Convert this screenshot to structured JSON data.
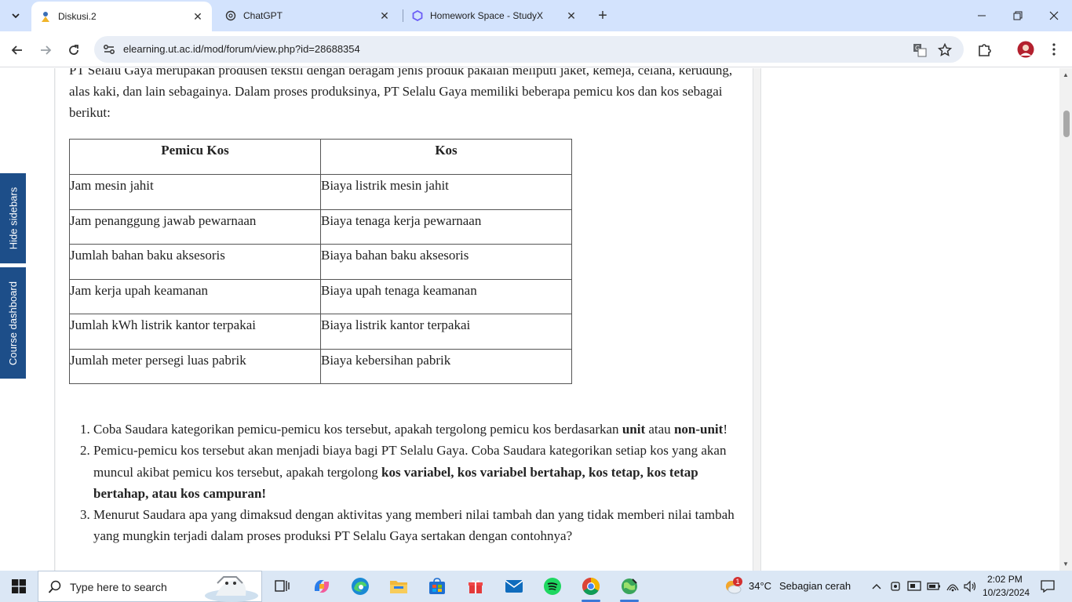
{
  "browser": {
    "tabs": [
      {
        "title": "Diskusi.2",
        "icon": "ut-logo-icon",
        "active": true
      },
      {
        "title": "ChatGPT",
        "icon": "chatgpt-icon",
        "active": false
      },
      {
        "title": "Homework Space - StudyX",
        "icon": "studyx-icon",
        "active": false
      }
    ],
    "url": "elearning.ut.ac.id/mod/forum/view.php?id=28688354"
  },
  "sidebar": {
    "hide_label": "Hide sidebars",
    "dashboard_label": "Course dashboard"
  },
  "post": {
    "intro": "PT Selalu Gaya merupakan produsen tekstil dengan beragam jenis produk pakaian meliputi jaket, kemeja, celana, kerudung, alas kaki, dan lain sebagainya. Dalam proses produksinya, PT Selalu Gaya memiliki beberapa pemicu kos dan kos sebagai berikut:",
    "table": {
      "headers": [
        "Pemicu Kos",
        "Kos"
      ],
      "rows": [
        [
          "Jam mesin jahit",
          "Biaya listrik mesin jahit"
        ],
        [
          "Jam penanggung jawab pewarnaan",
          "Biaya tenaga kerja pewarnaan"
        ],
        [
          "Jumlah bahan baku aksesoris",
          "Biaya bahan baku aksesoris"
        ],
        [
          "Jam kerja upah keamanan",
          "Biaya upah tenaga keamanan"
        ],
        [
          "Jumlah kWh listrik kantor terpakai",
          "Biaya listrik kantor terpakai"
        ],
        [
          "Jumlah meter persegi luas pabrik",
          "Biaya kebersihan pabrik"
        ]
      ]
    },
    "q1": {
      "pre": "Coba Saudara kategorikan pemicu-pemicu kos tersebut, apakah tergolong pemicu kos berdasarkan ",
      "b1": "unit",
      "mid": " atau ",
      "b2": "non-unit",
      "post": "!"
    },
    "q2": {
      "pre": "Pemicu-pemicu kos tersebut akan menjadi biaya bagi PT Selalu Gaya. Coba Saudara kategorikan setiap kos yang akan muncul akibat pemicu kos tersebut, apakah tergolong ",
      "bold": "kos variabel, kos variabel bertahap, kos tetap, kos tetap bertahap, atau kos campuran!"
    },
    "q3": "Menurut Saudara apa yang dimaksud dengan aktivitas yang memberi nilai tambah dan yang tidak memberi nilai tambah yang mungkin terjadi dalam proses produksi PT Selalu Gaya sertakan dengan contohnya?"
  },
  "taskbar": {
    "search_placeholder": "Type here to search",
    "weather_temp": "34°C",
    "weather_desc": "Sebagian cerah",
    "weather_badge": "1",
    "time": "2:02 PM",
    "date": "10/23/2024"
  }
}
